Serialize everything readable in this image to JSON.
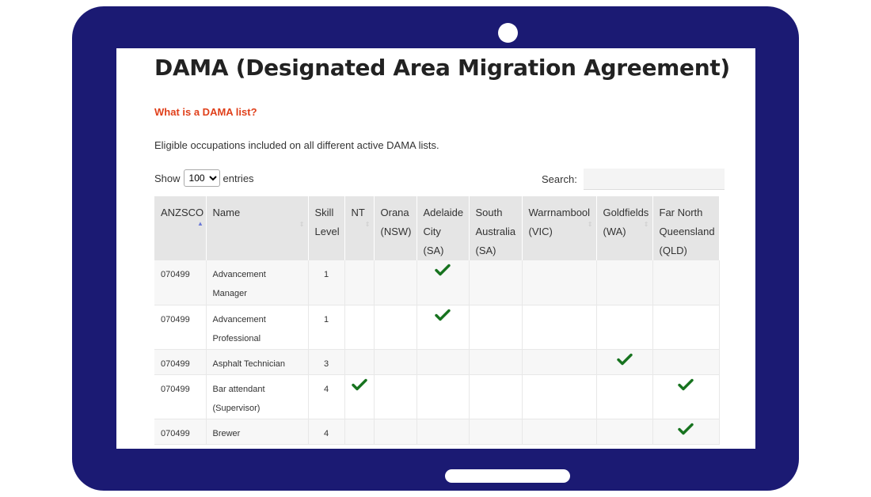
{
  "page": {
    "title": "DAMA (Designated Area Migration Agreement)",
    "link_text": "What is a DAMA list?",
    "intro": "Eligible occupations included on all different active DAMA lists."
  },
  "controls": {
    "show_label": "Show",
    "entries_selected": "100",
    "entries_label": "entries",
    "search_label": "Search:",
    "search_value": ""
  },
  "table": {
    "headers": [
      "ANZSCO",
      "Name",
      "Skill Level",
      "NT",
      "Orana (NSW)",
      "Adelaide City (SA)",
      "South Australia (SA)",
      "Warrnambool (VIC)",
      "Goldfields (WA)",
      "Far North Queensland (QLD)"
    ],
    "rows": [
      {
        "anzsco": "070499",
        "name": "Advancement Manager",
        "skill": "1",
        "checks": [
          false,
          false,
          true,
          false,
          false,
          false,
          false
        ]
      },
      {
        "anzsco": "070499",
        "name": "Advancement Professional",
        "skill": "1",
        "checks": [
          false,
          false,
          true,
          false,
          false,
          false,
          false
        ]
      },
      {
        "anzsco": "070499",
        "name": "Asphalt Technician",
        "skill": "3",
        "checks": [
          false,
          false,
          false,
          false,
          false,
          true,
          false
        ]
      },
      {
        "anzsco": "070499",
        "name": "Bar attendant (Supervisor)",
        "skill": "4",
        "checks": [
          true,
          false,
          false,
          false,
          false,
          false,
          true
        ]
      },
      {
        "anzsco": "070499",
        "name": "Brewer",
        "skill": "4",
        "checks": [
          false,
          false,
          false,
          false,
          false,
          false,
          true
        ]
      }
    ]
  },
  "colors": {
    "frame": "#1b1a73",
    "link": "#e0401b",
    "check": "#17731f",
    "header_bg": "#e5e5e5"
  },
  "icons": {
    "check": "checkmark-icon",
    "sort": "sort-arrows-icon"
  }
}
